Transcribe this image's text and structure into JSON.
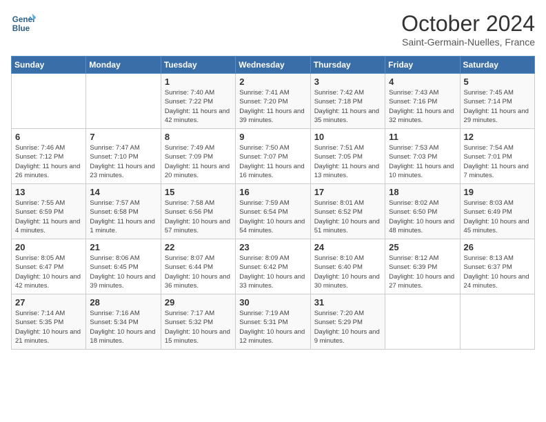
{
  "header": {
    "logo_line1": "General",
    "logo_line2": "Blue",
    "month": "October 2024",
    "location": "Saint-Germain-Nuelles, France"
  },
  "days_of_week": [
    "Sunday",
    "Monday",
    "Tuesday",
    "Wednesday",
    "Thursday",
    "Friday",
    "Saturday"
  ],
  "weeks": [
    [
      {
        "day": "",
        "info": ""
      },
      {
        "day": "",
        "info": ""
      },
      {
        "day": "1",
        "info": "Sunrise: 7:40 AM\nSunset: 7:22 PM\nDaylight: 11 hours and 42 minutes."
      },
      {
        "day": "2",
        "info": "Sunrise: 7:41 AM\nSunset: 7:20 PM\nDaylight: 11 hours and 39 minutes."
      },
      {
        "day": "3",
        "info": "Sunrise: 7:42 AM\nSunset: 7:18 PM\nDaylight: 11 hours and 35 minutes."
      },
      {
        "day": "4",
        "info": "Sunrise: 7:43 AM\nSunset: 7:16 PM\nDaylight: 11 hours and 32 minutes."
      },
      {
        "day": "5",
        "info": "Sunrise: 7:45 AM\nSunset: 7:14 PM\nDaylight: 11 hours and 29 minutes."
      }
    ],
    [
      {
        "day": "6",
        "info": "Sunrise: 7:46 AM\nSunset: 7:12 PM\nDaylight: 11 hours and 26 minutes."
      },
      {
        "day": "7",
        "info": "Sunrise: 7:47 AM\nSunset: 7:10 PM\nDaylight: 11 hours and 23 minutes."
      },
      {
        "day": "8",
        "info": "Sunrise: 7:49 AM\nSunset: 7:09 PM\nDaylight: 11 hours and 20 minutes."
      },
      {
        "day": "9",
        "info": "Sunrise: 7:50 AM\nSunset: 7:07 PM\nDaylight: 11 hours and 16 minutes."
      },
      {
        "day": "10",
        "info": "Sunrise: 7:51 AM\nSunset: 7:05 PM\nDaylight: 11 hours and 13 minutes."
      },
      {
        "day": "11",
        "info": "Sunrise: 7:53 AM\nSunset: 7:03 PM\nDaylight: 11 hours and 10 minutes."
      },
      {
        "day": "12",
        "info": "Sunrise: 7:54 AM\nSunset: 7:01 PM\nDaylight: 11 hours and 7 minutes."
      }
    ],
    [
      {
        "day": "13",
        "info": "Sunrise: 7:55 AM\nSunset: 6:59 PM\nDaylight: 11 hours and 4 minutes."
      },
      {
        "day": "14",
        "info": "Sunrise: 7:57 AM\nSunset: 6:58 PM\nDaylight: 11 hours and 1 minute."
      },
      {
        "day": "15",
        "info": "Sunrise: 7:58 AM\nSunset: 6:56 PM\nDaylight: 10 hours and 57 minutes."
      },
      {
        "day": "16",
        "info": "Sunrise: 7:59 AM\nSunset: 6:54 PM\nDaylight: 10 hours and 54 minutes."
      },
      {
        "day": "17",
        "info": "Sunrise: 8:01 AM\nSunset: 6:52 PM\nDaylight: 10 hours and 51 minutes."
      },
      {
        "day": "18",
        "info": "Sunrise: 8:02 AM\nSunset: 6:50 PM\nDaylight: 10 hours and 48 minutes."
      },
      {
        "day": "19",
        "info": "Sunrise: 8:03 AM\nSunset: 6:49 PM\nDaylight: 10 hours and 45 minutes."
      }
    ],
    [
      {
        "day": "20",
        "info": "Sunrise: 8:05 AM\nSunset: 6:47 PM\nDaylight: 10 hours and 42 minutes."
      },
      {
        "day": "21",
        "info": "Sunrise: 8:06 AM\nSunset: 6:45 PM\nDaylight: 10 hours and 39 minutes."
      },
      {
        "day": "22",
        "info": "Sunrise: 8:07 AM\nSunset: 6:44 PM\nDaylight: 10 hours and 36 minutes."
      },
      {
        "day": "23",
        "info": "Sunrise: 8:09 AM\nSunset: 6:42 PM\nDaylight: 10 hours and 33 minutes."
      },
      {
        "day": "24",
        "info": "Sunrise: 8:10 AM\nSunset: 6:40 PM\nDaylight: 10 hours and 30 minutes."
      },
      {
        "day": "25",
        "info": "Sunrise: 8:12 AM\nSunset: 6:39 PM\nDaylight: 10 hours and 27 minutes."
      },
      {
        "day": "26",
        "info": "Sunrise: 8:13 AM\nSunset: 6:37 PM\nDaylight: 10 hours and 24 minutes."
      }
    ],
    [
      {
        "day": "27",
        "info": "Sunrise: 7:14 AM\nSunset: 5:35 PM\nDaylight: 10 hours and 21 minutes."
      },
      {
        "day": "28",
        "info": "Sunrise: 7:16 AM\nSunset: 5:34 PM\nDaylight: 10 hours and 18 minutes."
      },
      {
        "day": "29",
        "info": "Sunrise: 7:17 AM\nSunset: 5:32 PM\nDaylight: 10 hours and 15 minutes."
      },
      {
        "day": "30",
        "info": "Sunrise: 7:19 AM\nSunset: 5:31 PM\nDaylight: 10 hours and 12 minutes."
      },
      {
        "day": "31",
        "info": "Sunrise: 7:20 AM\nSunset: 5:29 PM\nDaylight: 10 hours and 9 minutes."
      },
      {
        "day": "",
        "info": ""
      },
      {
        "day": "",
        "info": ""
      }
    ]
  ]
}
